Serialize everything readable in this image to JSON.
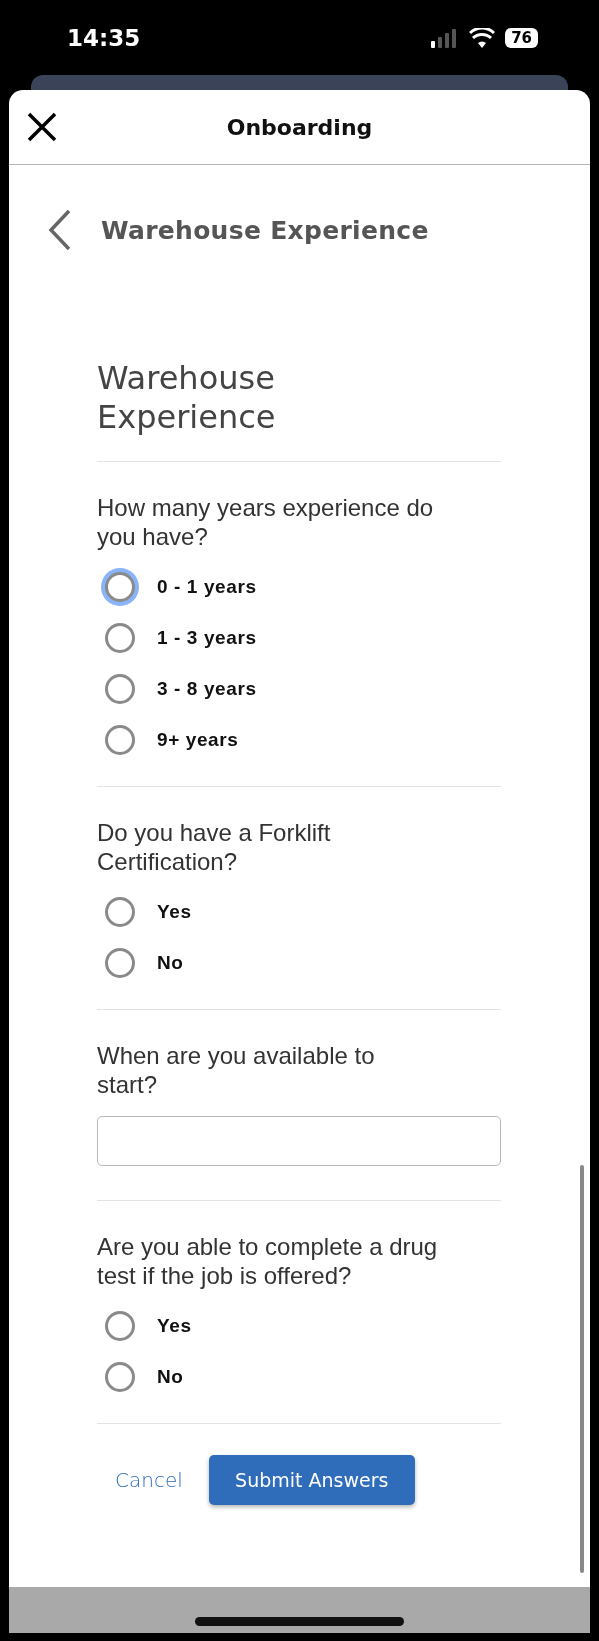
{
  "status_bar": {
    "time": "14:35",
    "battery": "76"
  },
  "header": {
    "title": "Onboarding"
  },
  "page": {
    "back_title": "Warehouse Experience",
    "title": "Warehouse Experience"
  },
  "questions": [
    {
      "kind": "radio",
      "text": "How many years experience do you have?",
      "options": [
        {
          "label": "0 - 1 years",
          "selected": false,
          "focused": true
        },
        {
          "label": "1 - 3 years",
          "selected": false,
          "focused": false
        },
        {
          "label": "3 - 8 years",
          "selected": false,
          "focused": false
        },
        {
          "label": "9+ years",
          "selected": false,
          "focused": false
        }
      ]
    },
    {
      "kind": "radio",
      "text": "Do you have a Forklift Certification?",
      "options": [
        {
          "label": "Yes",
          "selected": false,
          "focused": false
        },
        {
          "label": "No",
          "selected": false,
          "focused": false
        }
      ]
    },
    {
      "kind": "text",
      "text": "When are you available to start?"
    },
    {
      "kind": "radio",
      "text": "Are you able to complete a drug test if the job is offered?",
      "options": [
        {
          "label": "Yes",
          "selected": false,
          "focused": false
        },
        {
          "label": "No",
          "selected": false,
          "focused": false
        }
      ]
    }
  ],
  "actions": {
    "cancel": "Cancel",
    "submit": "Submit Answers"
  }
}
